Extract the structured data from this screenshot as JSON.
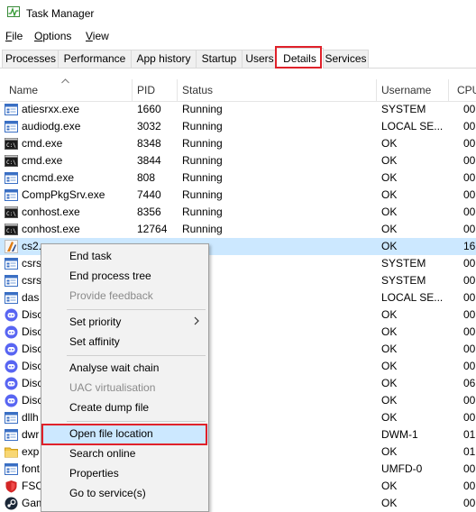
{
  "window": {
    "title": "Task Manager"
  },
  "menu": [
    {
      "label": "File",
      "name": "menu-file"
    },
    {
      "label": "Options",
      "name": "menu-options"
    },
    {
      "label": "View",
      "name": "menu-view"
    }
  ],
  "tabs": [
    {
      "label": "Processes",
      "name": "tab-processes"
    },
    {
      "label": "Performance",
      "name": "tab-performance"
    },
    {
      "label": "App history",
      "name": "tab-app-history"
    },
    {
      "label": "Startup",
      "name": "tab-startup"
    },
    {
      "label": "Users",
      "name": "tab-users"
    },
    {
      "label": "Details",
      "name": "tab-details",
      "active": true
    },
    {
      "label": "Services",
      "name": "tab-services"
    }
  ],
  "columns": {
    "name": "Name",
    "pid": "PID",
    "status": "Status",
    "username": "Username",
    "cpu": "CPU"
  },
  "rows": [
    {
      "name": "atiesrxx.exe",
      "pid": "1660",
      "status": "Running",
      "user": "SYSTEM",
      "cpu": "00",
      "icon": "window-app-icon"
    },
    {
      "name": "audiodg.exe",
      "pid": "3032",
      "status": "Running",
      "user": "LOCAL SE...",
      "cpu": "00",
      "icon": "window-app-icon"
    },
    {
      "name": "cmd.exe",
      "pid": "8348",
      "status": "Running",
      "user": "OK",
      "cpu": "00",
      "icon": "console-icon"
    },
    {
      "name": "cmd.exe",
      "pid": "3844",
      "status": "Running",
      "user": "OK",
      "cpu": "00",
      "icon": "console-icon"
    },
    {
      "name": "cncmd.exe",
      "pid": "808",
      "status": "Running",
      "user": "OK",
      "cpu": "00",
      "icon": "window-app-icon"
    },
    {
      "name": "CompPkgSrv.exe",
      "pid": "7440",
      "status": "Running",
      "user": "OK",
      "cpu": "00",
      "icon": "window-app-icon"
    },
    {
      "name": "conhost.exe",
      "pid": "8356",
      "status": "Running",
      "user": "OK",
      "cpu": "00",
      "icon": "console-icon"
    },
    {
      "name": "conhost.exe",
      "pid": "12764",
      "status": "Running",
      "user": "OK",
      "cpu": "00",
      "icon": "console-icon"
    },
    {
      "name": "cs2.",
      "pid": "",
      "status": "",
      "user": "OK",
      "cpu": "16",
      "icon": "cs2-icon",
      "selected": true
    },
    {
      "name": "csrs",
      "pid": "",
      "status": "",
      "user": "SYSTEM",
      "cpu": "00",
      "icon": "window-app-icon"
    },
    {
      "name": "csrs",
      "pid": "",
      "status": "",
      "user": "SYSTEM",
      "cpu": "00",
      "icon": "window-app-icon"
    },
    {
      "name": "das",
      "pid": "",
      "status": "",
      "user": "LOCAL SE...",
      "cpu": "00",
      "icon": "window-app-icon"
    },
    {
      "name": "Disc",
      "pid": "",
      "status": "",
      "user": "OK",
      "cpu": "00",
      "icon": "discord-icon"
    },
    {
      "name": "Disc",
      "pid": "",
      "status": "",
      "user": "OK",
      "cpu": "00",
      "icon": "discord-icon"
    },
    {
      "name": "Disc",
      "pid": "",
      "status": "",
      "user": "OK",
      "cpu": "00",
      "icon": "discord-icon"
    },
    {
      "name": "Disc",
      "pid": "",
      "status": "",
      "user": "OK",
      "cpu": "00",
      "icon": "discord-icon"
    },
    {
      "name": "Disc",
      "pid": "",
      "status": "",
      "user": "OK",
      "cpu": "06",
      "icon": "discord-icon"
    },
    {
      "name": "Disc",
      "pid": "",
      "status": "",
      "user": "OK",
      "cpu": "00",
      "icon": "discord-icon"
    },
    {
      "name": "dllh",
      "pid": "",
      "status": "",
      "user": "OK",
      "cpu": "00",
      "icon": "window-app-icon"
    },
    {
      "name": "dwr",
      "pid": "",
      "status": "",
      "user": "DWM-1",
      "cpu": "01",
      "icon": "window-app-icon"
    },
    {
      "name": "exp",
      "pid": "",
      "status": "",
      "user": "OK",
      "cpu": "01",
      "icon": "folder-icon"
    },
    {
      "name": "font",
      "pid": "",
      "status": "",
      "user": "UMFD-0",
      "cpu": "00",
      "icon": "window-app-icon"
    },
    {
      "name": "FSC",
      "pid": "",
      "status": "",
      "user": "OK",
      "cpu": "00",
      "icon": "shield-app-icon"
    },
    {
      "name": "Gam",
      "pid": "",
      "status": "",
      "user": "OK",
      "cpu": "00",
      "icon": "steam-icon"
    }
  ],
  "context_menu": [
    {
      "label": "End task",
      "name": "ctx-end-task"
    },
    {
      "label": "End process tree",
      "name": "ctx-end-process-tree"
    },
    {
      "label": "Provide feedback",
      "name": "ctx-provide-feedback",
      "disabled": true
    },
    {
      "sep": true
    },
    {
      "label": "Set priority",
      "name": "ctx-set-priority",
      "submenu": true
    },
    {
      "label": "Set affinity",
      "name": "ctx-set-affinity"
    },
    {
      "sep": true
    },
    {
      "label": "Analyse wait chain",
      "name": "ctx-analyse-wait-chain"
    },
    {
      "label": "UAC virtualisation",
      "name": "ctx-uac-virtualisation",
      "disabled": true
    },
    {
      "label": "Create dump file",
      "name": "ctx-create-dump-file"
    },
    {
      "sep": true
    },
    {
      "label": "Open file location",
      "name": "ctx-open-file-location",
      "hover": true
    },
    {
      "label": "Search online",
      "name": "ctx-search-online"
    },
    {
      "label": "Properties",
      "name": "ctx-properties"
    },
    {
      "label": "Go to service(s)",
      "name": "ctx-go-to-services"
    }
  ],
  "highlight_color": "#e0212a",
  "selection_color": "#cce8ff"
}
